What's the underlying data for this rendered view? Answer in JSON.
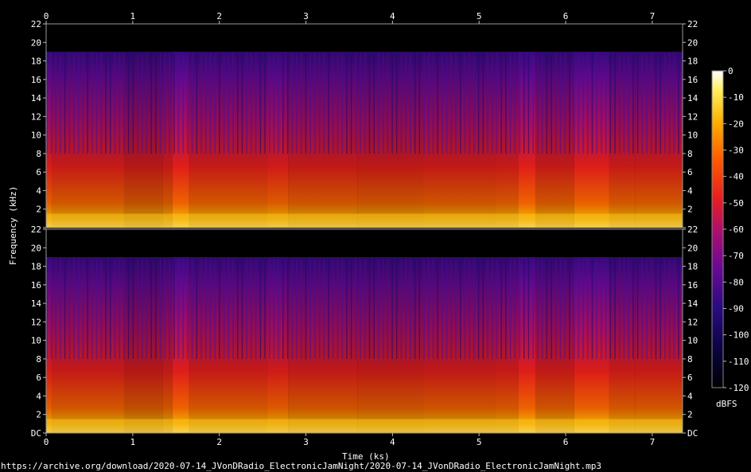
{
  "chart_data": {
    "type": "heatmap",
    "title": "",
    "xlabel": "Time (ks)",
    "ylabel": "Frequency (kHz)",
    "x_ticks": [
      "0",
      "1",
      "2",
      "3",
      "4",
      "5",
      "6",
      "7"
    ],
    "xlim": [
      0,
      7.35
    ],
    "ylim": [
      0,
      22
    ],
    "y_ticks": [
      "DC",
      "2",
      "4",
      "6",
      "8",
      "10",
      "12",
      "14",
      "16",
      "18",
      "20",
      "22"
    ],
    "channels": 2,
    "colorbar": {
      "label": "dBFS",
      "ticks": [
        "0",
        "-10",
        "-20",
        "-30",
        "-40",
        "-50",
        "-60",
        "-70",
        "-80",
        "-90",
        "-100",
        "-110",
        "-120"
      ],
      "range": [
        -120,
        0
      ]
    },
    "source_url": "https://archive.org/download/2020-07-14_JVonDRadio_ElectronicJamNight/2020-07-14_JVonDRadio_ElectronicJamNight.mp3",
    "segments_ks": [
      {
        "start": 0.0,
        "end": 0.07,
        "intensity": 0.75
      },
      {
        "start": 0.07,
        "end": 0.9,
        "intensity": 0.6
      },
      {
        "start": 0.9,
        "end": 1.35,
        "intensity": 0.45
      },
      {
        "start": 1.35,
        "end": 1.46,
        "intensity": 0.55
      },
      {
        "start": 1.46,
        "end": 1.65,
        "intensity": 0.85
      },
      {
        "start": 1.65,
        "end": 2.55,
        "intensity": 0.6
      },
      {
        "start": 2.55,
        "end": 2.8,
        "intensity": 0.7
      },
      {
        "start": 2.8,
        "end": 3.6,
        "intensity": 0.55
      },
      {
        "start": 3.6,
        "end": 4.35,
        "intensity": 0.5
      },
      {
        "start": 4.35,
        "end": 5.2,
        "intensity": 0.55
      },
      {
        "start": 5.2,
        "end": 5.45,
        "intensity": 0.6
      },
      {
        "start": 5.45,
        "end": 5.65,
        "intensity": 0.85
      },
      {
        "start": 5.65,
        "end": 6.1,
        "intensity": 0.55
      },
      {
        "start": 6.1,
        "end": 6.5,
        "intensity": 0.8
      },
      {
        "start": 6.5,
        "end": 6.8,
        "intensity": 0.6
      },
      {
        "start": 6.8,
        "end": 7.35,
        "intensity": 0.6
      }
    ]
  }
}
